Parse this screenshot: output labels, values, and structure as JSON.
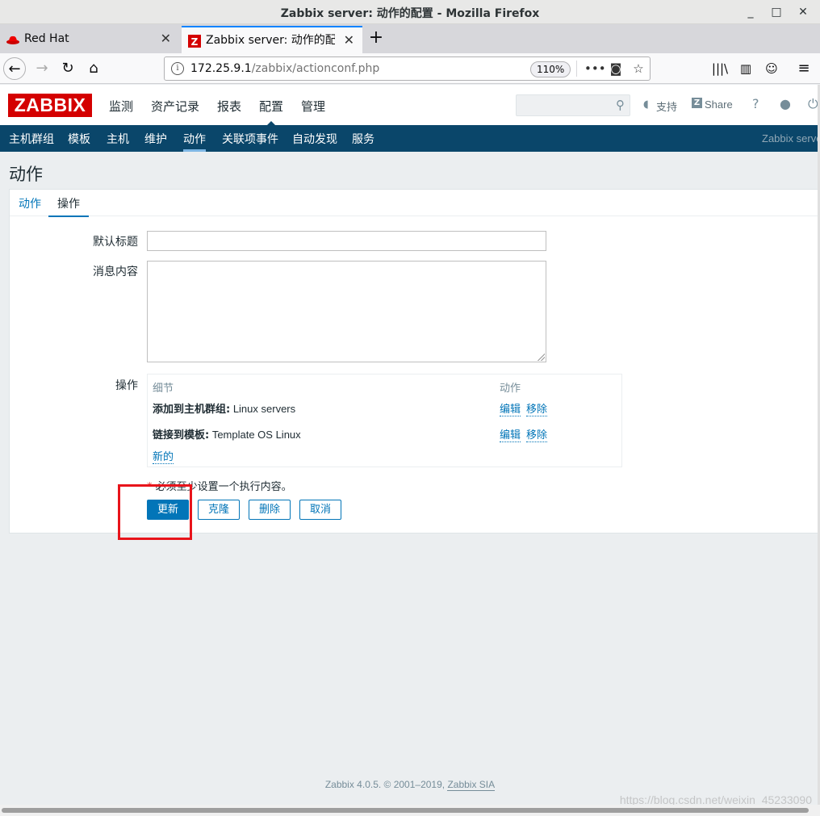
{
  "window": {
    "title": "Zabbix server: 动作的配置 - Mozilla Firefox"
  },
  "browser_tabs": [
    {
      "label": "Red Hat"
    },
    {
      "label": "Zabbix server: 动作的配置"
    }
  ],
  "url": {
    "host": "172.25.9.1",
    "path": "/zabbix/actionconf.php",
    "zoom": "110%"
  },
  "header": {
    "logo": "ZABBIX",
    "menu": [
      "监测",
      "资产记录",
      "报表",
      "配置",
      "管理"
    ],
    "support": "支持",
    "share": "Share",
    "help": "?"
  },
  "submenu": {
    "items": [
      "主机群组",
      "模板",
      "主机",
      "维护",
      "动作",
      "关联项事件",
      "自动发现",
      "服务"
    ],
    "server": "Zabbix server"
  },
  "page": {
    "title": "动作"
  },
  "form": {
    "tabs": [
      "动作",
      "操作"
    ],
    "default_subject_label": "默认标题",
    "default_subject_value": "",
    "message_label": "消息内容",
    "message_value": "",
    "operations_label": "操作",
    "ops_header_details": "细节",
    "ops_header_action": "动作",
    "operations": [
      {
        "type": "添加到主机群组:",
        "value": " Linux servers",
        "edit": "编辑",
        "remove": "移除"
      },
      {
        "type": "链接到模板:",
        "value": " Template OS Linux",
        "edit": "编辑",
        "remove": "移除"
      }
    ],
    "new_link": "新的",
    "required_star": "*",
    "required_note": " 必须至少设置一个执行内容。",
    "buttons": {
      "update": "更新",
      "clone": "克隆",
      "delete": "删除",
      "cancel": "取消"
    }
  },
  "footer": {
    "text": "Zabbix 4.0.5. © 2001–2019, ",
    "company": "Zabbix SIA"
  },
  "watermark": "https://blog.csdn.net/weixin_45233090"
}
